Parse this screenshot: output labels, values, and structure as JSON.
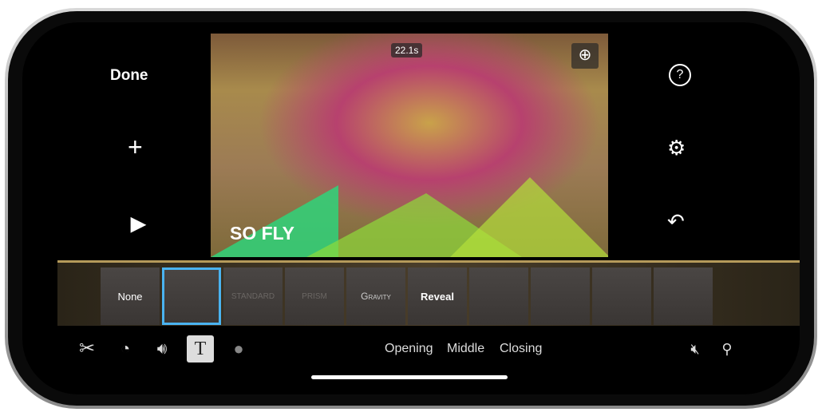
{
  "left_controls": {
    "done": "Done",
    "add_icon": "plus-icon",
    "play_icon": "play-icon"
  },
  "right_controls": {
    "help": "?",
    "settings_icon": "gear-icon",
    "undo_icon": "undo-icon"
  },
  "video": {
    "duration": "22.1s",
    "title_text": "SO FLY",
    "zoom_icon": "zoom-in-icon"
  },
  "title_styles": [
    {
      "label": "None",
      "selected": false
    },
    {
      "label": "",
      "selected": true
    },
    {
      "label": "STANDARD",
      "selected": false
    },
    {
      "label": "PRISM",
      "selected": false
    },
    {
      "label": "Gravity",
      "selected": false
    },
    {
      "label": "Reveal",
      "selected": false
    },
    {
      "label": "",
      "selected": false
    },
    {
      "label": "",
      "selected": false
    },
    {
      "label": "",
      "selected": false
    },
    {
      "label": "",
      "selected": false
    }
  ],
  "toolbar": {
    "tools": [
      "scissors-icon",
      "speed-icon",
      "volume-icon",
      "text-icon",
      "filters-icon"
    ],
    "active": "text-icon"
  },
  "positions": {
    "opening": "Opening",
    "middle": "Middle",
    "closing": "Closing"
  },
  "accent": "#4ab3f0"
}
